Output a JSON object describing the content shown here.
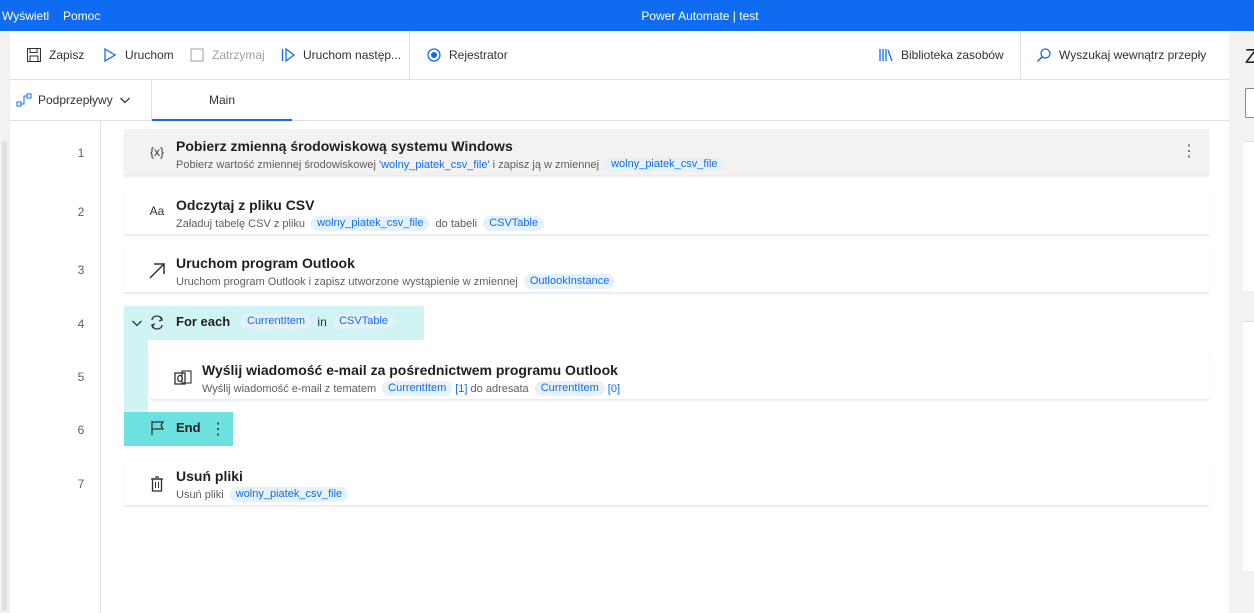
{
  "titlebar": {
    "menu": [
      "Wyświetl",
      "Pomoc"
    ],
    "title": "Power Automate | test"
  },
  "toolbar": {
    "save": "Zapisz",
    "run": "Uruchom",
    "stop": "Zatrzymaj",
    "run_next": "Uruchom następ...",
    "recorder": "Rejestrator",
    "assets": "Biblioteka zasobów",
    "search": "Wyszukaj wewnątrz przepły"
  },
  "tabs": {
    "subflows": "Podprzepływy",
    "main": "Main"
  },
  "lines": [
    "1",
    "2",
    "3",
    "4",
    "5",
    "6",
    "7"
  ],
  "actions": {
    "a1": {
      "icon": "{x}",
      "title": "Pobierz zmienną środowiskową systemu Windows",
      "d1": "Pobierz wartość zmiennej środowiskowej",
      "d2": "'wolny_piatek_csv_file'",
      "d3": "i zapisz ją w zmiennej",
      "t1": "wolny_piatek_csv_file"
    },
    "a2": {
      "icon": "Aa",
      "title": "Odczytaj z pliku CSV",
      "d1": "Załaduj tabelę CSV z pliku",
      "t1": "wolny_piatek_csv_file",
      "d2": "do tabeli",
      "t2": "CSVTable"
    },
    "a3": {
      "title": "Uruchom program Outlook",
      "d1": "Uruchom program Outlook i zapisz utworzone wystąpienie w zmiennej",
      "t1": "OutlookInstance"
    },
    "loop": {
      "title": "For each",
      "t1": "CurrentItem",
      "in": "in",
      "t2": "CSVTable"
    },
    "a5": {
      "title": "Wyślij wiadomość e-mail za pośrednictwem programu Outlook",
      "d1": "Wyślij wiadomość e-mail z tematem",
      "t1": "CurrentItem",
      "i1": "[1]",
      "d2": "do adresata",
      "t2": "CurrentItem",
      "i2": "[0]"
    },
    "end": {
      "title": "End"
    },
    "a7": {
      "title": "Usuń pliki",
      "d1": "Usuń pliki",
      "t1": "wolny_piatek_csv_file"
    }
  },
  "rightpanel": {
    "letter": "Z"
  },
  "colors": {
    "accent": "#0f6cf0",
    "loop": "#d0f4f4",
    "end": "#6de1df"
  }
}
